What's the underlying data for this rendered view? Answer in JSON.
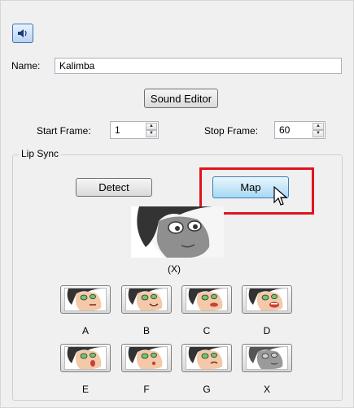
{
  "name": {
    "label": "Name:",
    "value": "Kalimba"
  },
  "sound_editor_label": "Sound Editor",
  "start_frame": {
    "label": "Start Frame:",
    "value": "1"
  },
  "stop_frame": {
    "label": "Stop Frame:",
    "value": "60"
  },
  "lip_sync": {
    "title": "Lip Sync",
    "detect_label": "Detect",
    "map_label": "Map",
    "current_mouth_label": "(X)",
    "mouths": [
      {
        "label": "A",
        "mouth": "a",
        "tone": "skin"
      },
      {
        "label": "B",
        "mouth": "b",
        "tone": "skin"
      },
      {
        "label": "C",
        "mouth": "c",
        "tone": "skin"
      },
      {
        "label": "D",
        "mouth": "d",
        "tone": "skin"
      },
      {
        "label": "E",
        "mouth": "e",
        "tone": "skin"
      },
      {
        "label": "F",
        "mouth": "f",
        "tone": "skin"
      },
      {
        "label": "G",
        "mouth": "g",
        "tone": "skin"
      },
      {
        "label": "X",
        "mouth": "x",
        "tone": "gray"
      }
    ]
  },
  "icons": {
    "sound": "speaker-icon",
    "cursor": "mouse-pointer-icon",
    "spin": "spin-arrows-icon"
  },
  "colors": {
    "highlight": "#e0141d",
    "skin": "#f3c9a9",
    "hair": "#333333",
    "eye": "#6fc96a",
    "lip": "#c4423a"
  }
}
